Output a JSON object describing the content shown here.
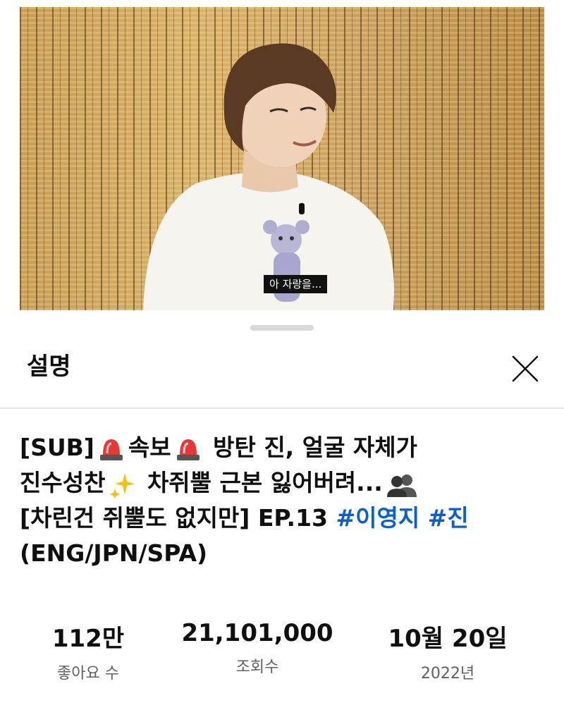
{
  "video": {
    "subtitle": "아 자랑을..."
  },
  "sheet": {
    "title": "설명",
    "close_icon": "close-x-icon"
  },
  "description": {
    "title_lines": [
      {
        "prefix": "[SUB]",
        "emoji1": "siren-emoji",
        "word": "속보",
        "emoji2": "siren-emoji",
        "rest": " 방탄 진, 얼굴 자체가"
      },
      {
        "text": "진수성찬",
        "emoji": "sparkles-emoji",
        "rest": " 차쥐뿔 근본 잃어버려...",
        "emoji2": "busts-emoji"
      },
      {
        "text": "[차린건 쥐뿔도 없지만] EP.13 ",
        "hashtags": [
          "#이영지",
          "#진"
        ]
      },
      {
        "text": "(ENG/JPN/SPA)"
      }
    ]
  },
  "stats": [
    {
      "value": "112만",
      "label": "좋아요 수"
    },
    {
      "value": "21,101,000",
      "label": "조회수"
    },
    {
      "value": "10월 20일",
      "label": "2022년"
    }
  ]
}
